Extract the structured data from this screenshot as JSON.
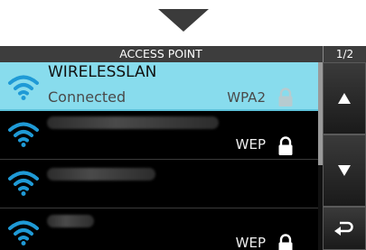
{
  "header": {
    "title": "ACCESS POINT",
    "page": "1/2"
  },
  "access_points": [
    {
      "ssid": "WIRELESSLAN",
      "status": "Connected",
      "encryption": "WPA2",
      "selected": true
    },
    {
      "ssid": "",
      "status": "",
      "encryption": "WEP",
      "selected": false
    },
    {
      "ssid": "",
      "status": "",
      "encryption": "",
      "selected": false
    },
    {
      "ssid": "",
      "status": "",
      "encryption": "WEP",
      "selected": false
    }
  ],
  "colors": {
    "selected_row": "#88dced",
    "wifi_icon": "#1f9ad6",
    "background": "#000000"
  },
  "icons": {
    "pointer": "down-triangle-icon",
    "signal": "wifi-icon",
    "lock": "lock-icon",
    "up": "up-arrow-icon",
    "down": "down-arrow-icon",
    "back": "return-arrow-icon"
  }
}
